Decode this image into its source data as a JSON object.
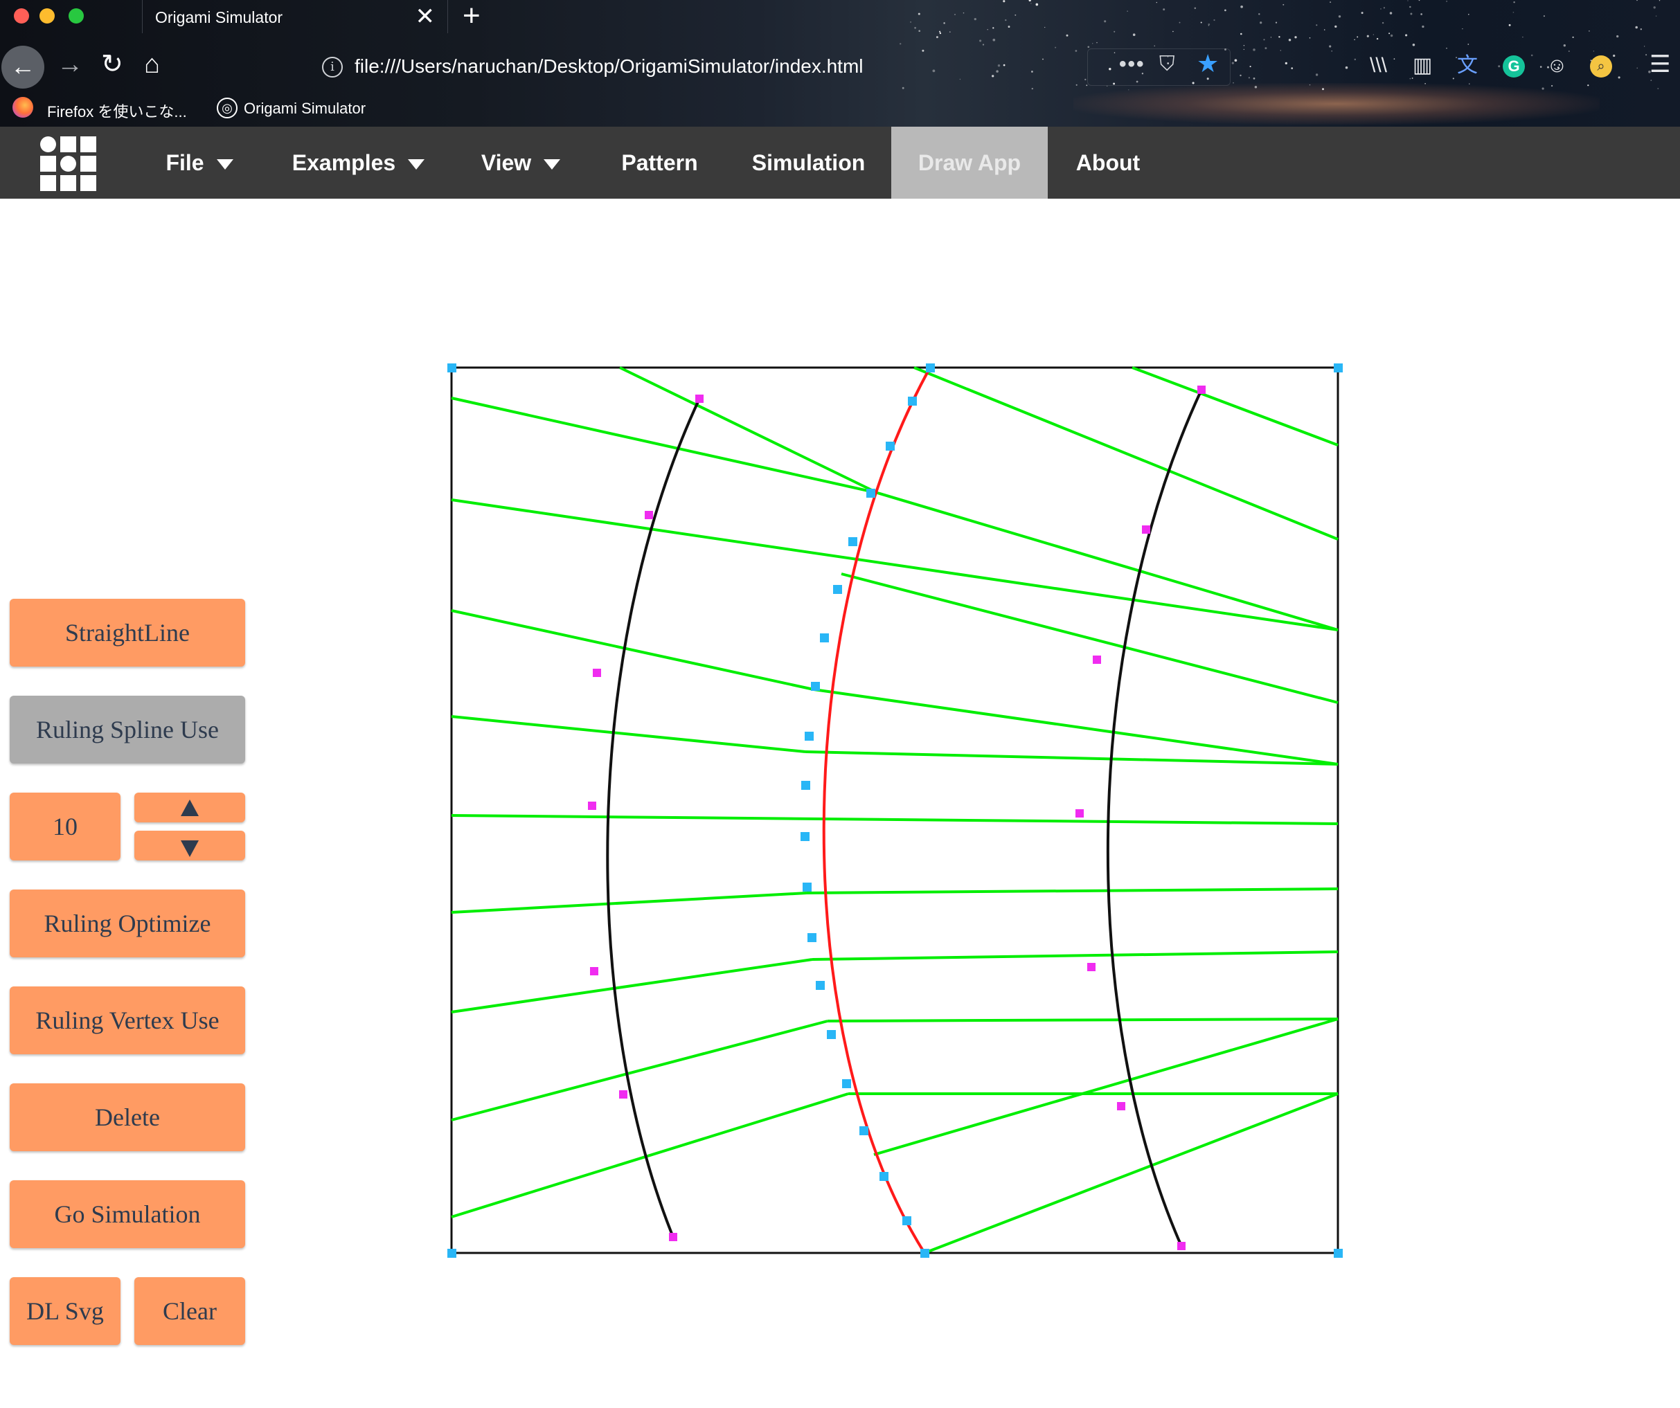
{
  "browser": {
    "tab_title": "Origami Simulator",
    "tab_close": "✕",
    "new_tab": "+",
    "url": "file:///Users/naruchan/Desktop/OrigamiSimulator/index.html",
    "bookmarks": [
      {
        "label": "Firefox を使いこな...",
        "icon": "firefox-icon"
      },
      {
        "label": "Origami Simulator",
        "icon": "globe-icon"
      }
    ],
    "icons": {
      "back": "←",
      "forward": "→",
      "reload": "↻",
      "home": "⌂",
      "info": "i",
      "more": "•••",
      "pocket": "⛉",
      "star": "★",
      "library": "\\\\\\",
      "reader": "▥",
      "translate": "文",
      "grammarly": "G",
      "ghost": "☺",
      "search": "⌕",
      "menu": "☰"
    }
  },
  "appnav": {
    "items": [
      {
        "label": "File",
        "dropdown": true
      },
      {
        "label": "Examples",
        "dropdown": true
      },
      {
        "label": "View",
        "dropdown": true
      },
      {
        "label": "Pattern",
        "dropdown": false
      },
      {
        "label": "Simulation",
        "dropdown": false
      },
      {
        "label": "Draw App",
        "dropdown": false,
        "active": true
      },
      {
        "label": "About",
        "dropdown": false
      }
    ]
  },
  "sidebar": {
    "straight_line": "StraightLine",
    "ruling_spline_use": "Ruling Spline Use",
    "ruling_count": "10",
    "ruling_optimize": "Ruling Optimize",
    "ruling_vertex_use": "Ruling Vertex Use",
    "delete": "Delete",
    "go_simulation": "Go Simulation",
    "dl_svg": "DL Svg",
    "clear": "Clear"
  },
  "canvas": {
    "colors": {
      "border": "#111111",
      "curve": "#111111",
      "crease_curve": "#ff1a1a",
      "ruling": "#00ee00",
      "vertex_point": "#29b6f6",
      "control_point": "#f02cf0"
    }
  }
}
